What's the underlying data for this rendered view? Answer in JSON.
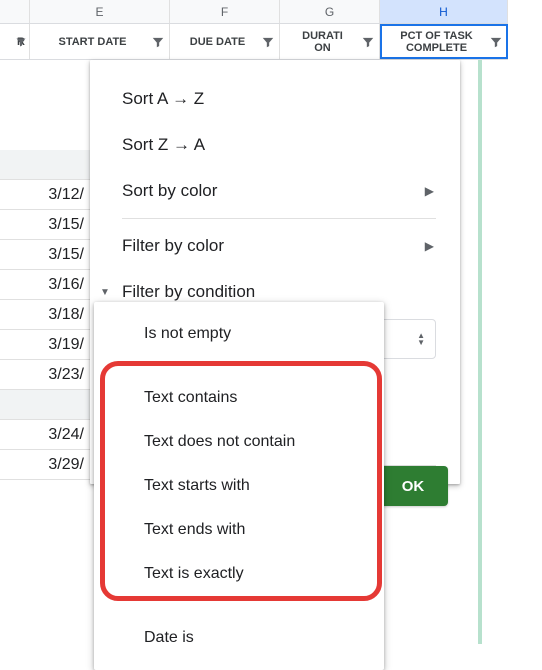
{
  "columns": {
    "letters": [
      "E",
      "F",
      "G",
      "H"
    ],
    "active_index": 3,
    "widths": [
      140,
      110,
      100,
      128
    ],
    "offsets": [
      30,
      170,
      280,
      380
    ],
    "titles": [
      "START DATE",
      "DUE DATE",
      "DURATI\nON",
      "PCT OF TASK COMPLETE"
    ]
  },
  "row0_label": "R",
  "visible_dates": [
    "3/12/",
    "3/15/",
    "3/15/",
    "3/16/",
    "3/18/",
    "3/19/",
    "3/23/",
    "",
    "3/24/",
    "3/29/"
  ],
  "panel": {
    "sort_az": "Sort A → Z",
    "sort_za": "Sort Z → A",
    "sort_color": "Sort by color",
    "filter_color": "Filter by color",
    "filter_cond": "Filter by condition"
  },
  "cond_select": {
    "value": "Is not empty"
  },
  "cond_options": {
    "text_contains": "Text contains",
    "text_not_contain": "Text does not contain",
    "text_starts": "Text starts with",
    "text_ends": "Text ends with",
    "text_exact": "Text is exactly",
    "date_is": "Date is"
  },
  "ok_label": "OK"
}
